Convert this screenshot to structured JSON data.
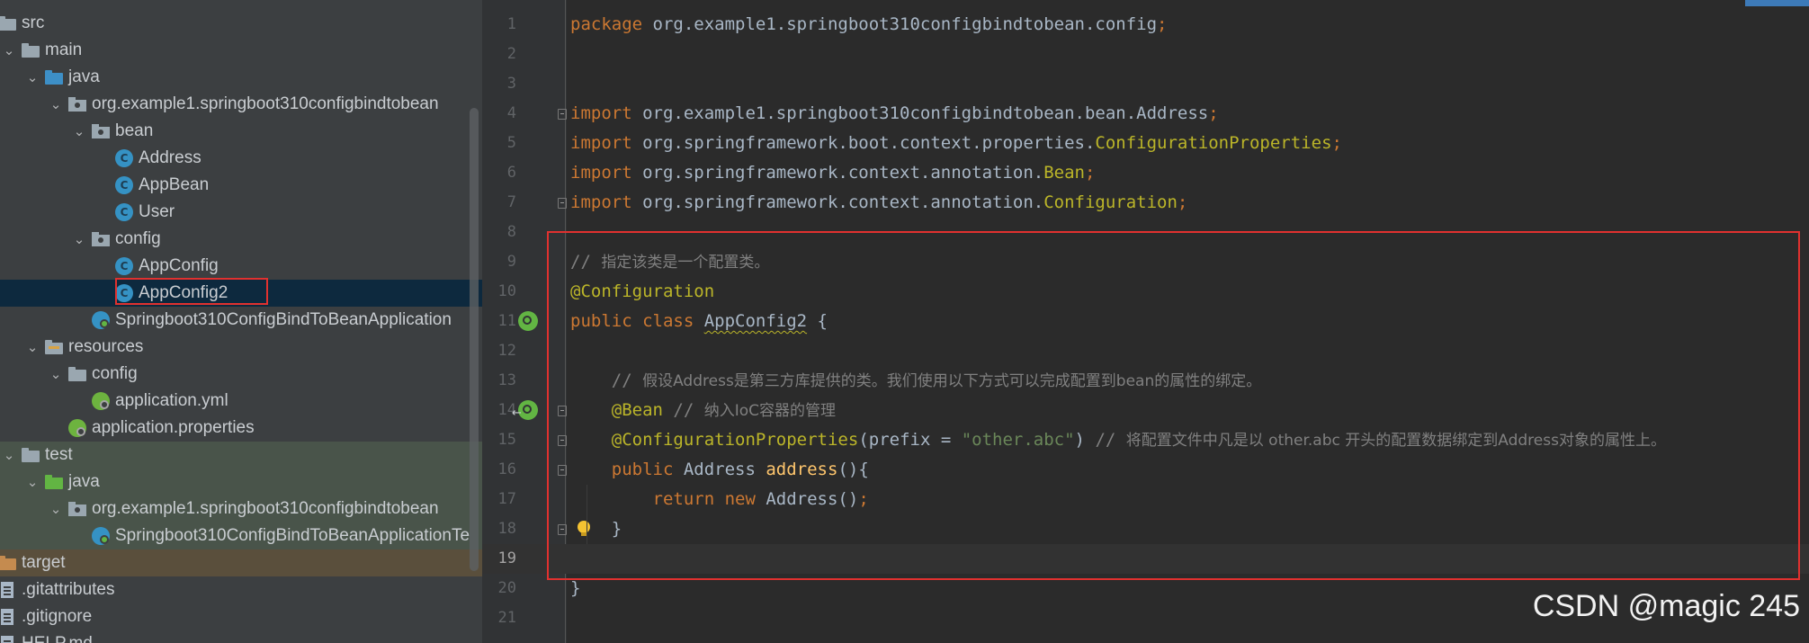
{
  "tree": {
    "items": [
      {
        "label": "src",
        "icon": "folder-icon",
        "expanded": true
      },
      {
        "label": "main",
        "icon": "folder-icon",
        "expanded": true
      },
      {
        "label": "java",
        "icon": "source-folder-icon",
        "expanded": true
      },
      {
        "label": "org.example1.springboot310configbindtobean",
        "icon": "package-icon",
        "expanded": true
      },
      {
        "label": "bean",
        "icon": "package-icon",
        "expanded": true
      },
      {
        "label": "Address",
        "icon": "class-icon"
      },
      {
        "label": "AppBean",
        "icon": "class-icon"
      },
      {
        "label": "User",
        "icon": "class-icon"
      },
      {
        "label": "config",
        "icon": "package-icon",
        "expanded": true
      },
      {
        "label": "AppConfig",
        "icon": "class-icon"
      },
      {
        "label": "AppConfig2",
        "icon": "class-icon",
        "selected": true
      },
      {
        "label": "Springboot310ConfigBindToBeanApplication",
        "icon": "spring-boot-class-icon"
      },
      {
        "label": "resources",
        "icon": "resources-folder-icon",
        "expanded": true
      },
      {
        "label": "config",
        "icon": "folder-icon",
        "expanded": true
      },
      {
        "label": "application.yml",
        "icon": "spring-config-icon"
      },
      {
        "label": "application.properties",
        "icon": "spring-config-icon"
      },
      {
        "label": "test",
        "icon": "folder-icon",
        "expanded": true
      },
      {
        "label": "java",
        "icon": "test-folder-icon",
        "expanded": true
      },
      {
        "label": "org.example1.springboot310configbindtobean",
        "icon": "package-icon",
        "expanded": true
      },
      {
        "label": "Springboot310ConfigBindToBeanApplicationTe",
        "icon": "spring-boot-test-class-icon"
      },
      {
        "label": "target",
        "icon": "excluded-folder-icon"
      },
      {
        "label": ".gitattributes",
        "icon": "text-file-icon"
      },
      {
        "label": ".gitignore",
        "icon": "text-file-icon"
      },
      {
        "label": "HELP.md",
        "icon": "markdown-file-icon"
      }
    ]
  },
  "editor": {
    "current_line": 19,
    "lines": [
      {
        "n": "1",
        "t": [
          [
            "kw",
            "package "
          ],
          [
            "plain",
            "org.example1.springboot310configbindtobean.config"
          ],
          [
            "kw",
            ";"
          ]
        ]
      },
      {
        "n": "2",
        "t": []
      },
      {
        "n": "3",
        "t": []
      },
      {
        "n": "4",
        "t": [
          [
            "kw",
            "import "
          ],
          [
            "plain",
            "org.example1.springboot310configbindtobean.bean.Address"
          ],
          [
            "kw",
            ";"
          ]
        ]
      },
      {
        "n": "5",
        "t": [
          [
            "kw",
            "import "
          ],
          [
            "plain",
            "org.springframework.boot.context.properties."
          ],
          [
            "ann",
            "ConfigurationProperties"
          ],
          [
            "kw",
            ";"
          ]
        ]
      },
      {
        "n": "6",
        "t": [
          [
            "kw",
            "import "
          ],
          [
            "plain",
            "org.springframework.context.annotation."
          ],
          [
            "ann",
            "Bean"
          ],
          [
            "kw",
            ";"
          ]
        ]
      },
      {
        "n": "7",
        "t": [
          [
            "kw",
            "import "
          ],
          [
            "plain",
            "org.springframework.context.annotation."
          ],
          [
            "ann",
            "Configuration"
          ],
          [
            "kw",
            ";"
          ]
        ]
      },
      {
        "n": "8",
        "t": []
      },
      {
        "n": "9",
        "t": [
          [
            "cmt",
            "// "
          ],
          [
            "cmt-cn",
            "指定该类是一个配置类。"
          ]
        ]
      },
      {
        "n": "10",
        "t": [
          [
            "ann",
            "@Configuration"
          ]
        ]
      },
      {
        "n": "11",
        "t": [
          [
            "kw",
            "public class "
          ],
          [
            "cls-under",
            "AppConfig2"
          ],
          [
            "plain",
            " {"
          ]
        ]
      },
      {
        "n": "12",
        "t": []
      },
      {
        "n": "13",
        "t": [
          [
            "plain",
            "    "
          ],
          [
            "cmt",
            "// "
          ],
          [
            "cmt-cn",
            "假设Address是第三方库提供的类。我们使用以下方式可以完成配置到bean的属性的绑定。"
          ]
        ]
      },
      {
        "n": "14",
        "t": [
          [
            "plain",
            "    "
          ],
          [
            "ann",
            "@Bean"
          ],
          [
            "cmt",
            " // "
          ],
          [
            "cmt-cn",
            "纳入IoC容器的管理"
          ]
        ]
      },
      {
        "n": "15",
        "t": [
          [
            "plain",
            "    "
          ],
          [
            "ann",
            "@ConfigurationProperties"
          ],
          [
            "plain",
            "(prefix = "
          ],
          [
            "str",
            "\"other.abc\""
          ],
          [
            "plain",
            ") "
          ],
          [
            "cmt",
            "// "
          ],
          [
            "cmt-cn",
            "将配置文件中凡是以 other.abc 开头的配置数据绑定到Address对象的属性上。"
          ]
        ]
      },
      {
        "n": "16",
        "t": [
          [
            "plain",
            "    "
          ],
          [
            "kw",
            "public "
          ],
          [
            "plain",
            "Address "
          ],
          [
            "fn",
            "address"
          ],
          [
            "plain",
            "(){"
          ]
        ]
      },
      {
        "n": "17",
        "t": [
          [
            "plain",
            "        "
          ],
          [
            "kw",
            "return new "
          ],
          [
            "plain",
            "Address()"
          ],
          [
            "kw",
            ";"
          ]
        ]
      },
      {
        "n": "18",
        "t": [
          [
            "plain",
            "    }"
          ]
        ]
      },
      {
        "n": "19",
        "t": []
      },
      {
        "n": "20",
        "t": [
          [
            "plain",
            "}"
          ]
        ]
      },
      {
        "n": "21",
        "t": []
      }
    ]
  },
  "watermark": "CSDN @magic 245",
  "colors": {
    "highlight_box": "#e0312f",
    "selection": "#0d293e",
    "keyword": "#cc7832",
    "annotation": "#bbb529"
  }
}
